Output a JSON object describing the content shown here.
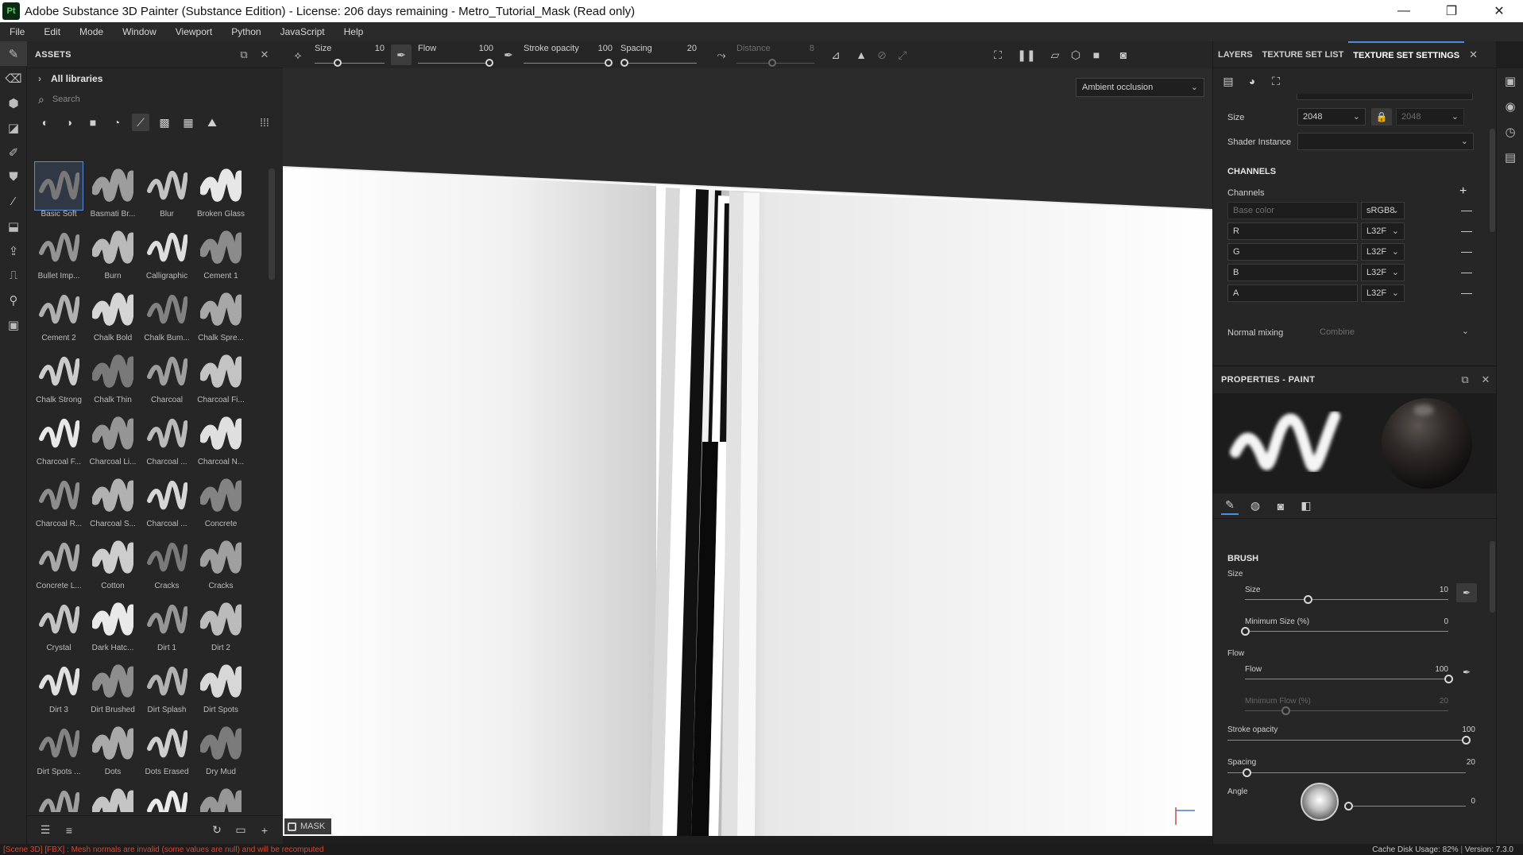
{
  "window": {
    "logo": "Pt",
    "title": "Adobe Substance 3D Painter (Substance Edition) - License: 206 days remaining - Metro_Tutorial_Mask (Read only)",
    "controls": {
      "minimize": "—",
      "maximize": "❐",
      "close": "✕"
    }
  },
  "menu": [
    "File",
    "Edit",
    "Mode",
    "Window",
    "Viewport",
    "Python",
    "JavaScript",
    "Help"
  ],
  "assets": {
    "title": "ASSETS",
    "library": "All libraries",
    "search_placeholder": "Search",
    "brushes": [
      {
        "label": "Basic Soft",
        "selected": true
      },
      {
        "label": "Basmati Br...",
        "selected": false
      },
      {
        "label": "Blur",
        "selected": false
      },
      {
        "label": "Broken Glass",
        "selected": false
      },
      {
        "label": "Bullet Imp...",
        "selected": false
      },
      {
        "label": "Burn",
        "selected": false
      },
      {
        "label": "Calligraphic",
        "selected": false
      },
      {
        "label": "Cement 1",
        "selected": false
      },
      {
        "label": "Cement 2",
        "selected": false
      },
      {
        "label": "Chalk Bold",
        "selected": false
      },
      {
        "label": "Chalk Bum...",
        "selected": false
      },
      {
        "label": "Chalk Spre...",
        "selected": false
      },
      {
        "label": "Chalk Strong",
        "selected": false
      },
      {
        "label": "Chalk Thin",
        "selected": false
      },
      {
        "label": "Charcoal",
        "selected": false
      },
      {
        "label": "Charcoal Fi...",
        "selected": false
      },
      {
        "label": "Charcoal F...",
        "selected": false
      },
      {
        "label": "Charcoal Li...",
        "selected": false
      },
      {
        "label": "Charcoal ...",
        "selected": false
      },
      {
        "label": "Charcoal N...",
        "selected": false
      },
      {
        "label": "Charcoal R...",
        "selected": false
      },
      {
        "label": "Charcoal S...",
        "selected": false
      },
      {
        "label": "Charcoal ...",
        "selected": false
      },
      {
        "label": "Concrete",
        "selected": false
      },
      {
        "label": "Concrete L...",
        "selected": false
      },
      {
        "label": "Cotton",
        "selected": false
      },
      {
        "label": "Cracks",
        "selected": false
      },
      {
        "label": "Cracks",
        "selected": false
      },
      {
        "label": "Crystal",
        "selected": false
      },
      {
        "label": "Dark Hatc...",
        "selected": false
      },
      {
        "label": "Dirt 1",
        "selected": false
      },
      {
        "label": "Dirt 2",
        "selected": false
      },
      {
        "label": "Dirt 3",
        "selected": false
      },
      {
        "label": "Dirt Brushed",
        "selected": false
      },
      {
        "label": "Dirt Splash",
        "selected": false
      },
      {
        "label": "Dirt Spots",
        "selected": false
      },
      {
        "label": "Dirt Spots ...",
        "selected": false
      },
      {
        "label": "Dots",
        "selected": false
      },
      {
        "label": "Dots Erased",
        "selected": false
      },
      {
        "label": "Dry Mud",
        "selected": false
      },
      {
        "label": "",
        "selected": false
      },
      {
        "label": "",
        "selected": false
      },
      {
        "label": "",
        "selected": false
      },
      {
        "label": "",
        "selected": false
      }
    ]
  },
  "toolbar": {
    "size_label": "Size",
    "size_value": "10",
    "flow_label": "Flow",
    "flow_value": "100",
    "opacity_label": "Stroke opacity",
    "opacity_value": "100",
    "spacing_label": "Spacing",
    "spacing_value": "20",
    "distance_label": "Distance",
    "distance_value": "8"
  },
  "viewport": {
    "display_mode": "Ambient occlusion",
    "mask_label": "MASK"
  },
  "texture_set": {
    "tabs": [
      "LAYERS",
      "TEXTURE SET LIST",
      "TEXTURE SET SETTINGS"
    ],
    "active_tab": "TEXTURE SET SETTINGS",
    "size_label": "Size",
    "size_value": "2048",
    "size_value_locked": "2048",
    "shader_label": "Shader Instance",
    "shader_value": "",
    "channels_section": "CHANNELS",
    "channels_label": "Channels",
    "channels": [
      {
        "name": "Base color",
        "format": "sRGB8",
        "dim": true
      },
      {
        "name": "R",
        "format": "L32F",
        "dim": false
      },
      {
        "name": "G",
        "format": "L32F",
        "dim": false
      },
      {
        "name": "B",
        "format": "L32F",
        "dim": false
      },
      {
        "name": "A",
        "format": "L32F",
        "dim": false
      }
    ],
    "normal_mixing_label": "Normal mixing",
    "normal_mixing_value": "Combine"
  },
  "properties": {
    "title": "PROPERTIES - PAINT",
    "brush_section": "BRUSH",
    "size_group": "Size",
    "size_label": "Size",
    "size_value": "10",
    "size_fraction": 0.31,
    "min_size_label": "Minimum Size (%)",
    "min_size_value": "0",
    "min_size_fraction": 0.0,
    "flow_group": "Flow",
    "flow_label": "Flow",
    "flow_value": "100",
    "flow_fraction": 1.0,
    "min_flow_label": "Minimum Flow (%)",
    "min_flow_value": "20",
    "min_flow_fraction": 0.2,
    "opacity_label": "Stroke opacity",
    "opacity_value": "100",
    "opacity_fraction": 1.0,
    "spacing_label": "Spacing",
    "spacing_value": "20",
    "spacing_fraction": 0.08,
    "angle_label": "Angle",
    "angle_value": "0",
    "angle_fraction": 0.0
  },
  "status": {
    "error": "[Scene 3D] [FBX] : Mesh normals are invalid (some values are null) and will be recomputed",
    "cache": "Cache Disk Usage:",
    "cache_value": "82%",
    "version": "Version: 7.3.0"
  }
}
